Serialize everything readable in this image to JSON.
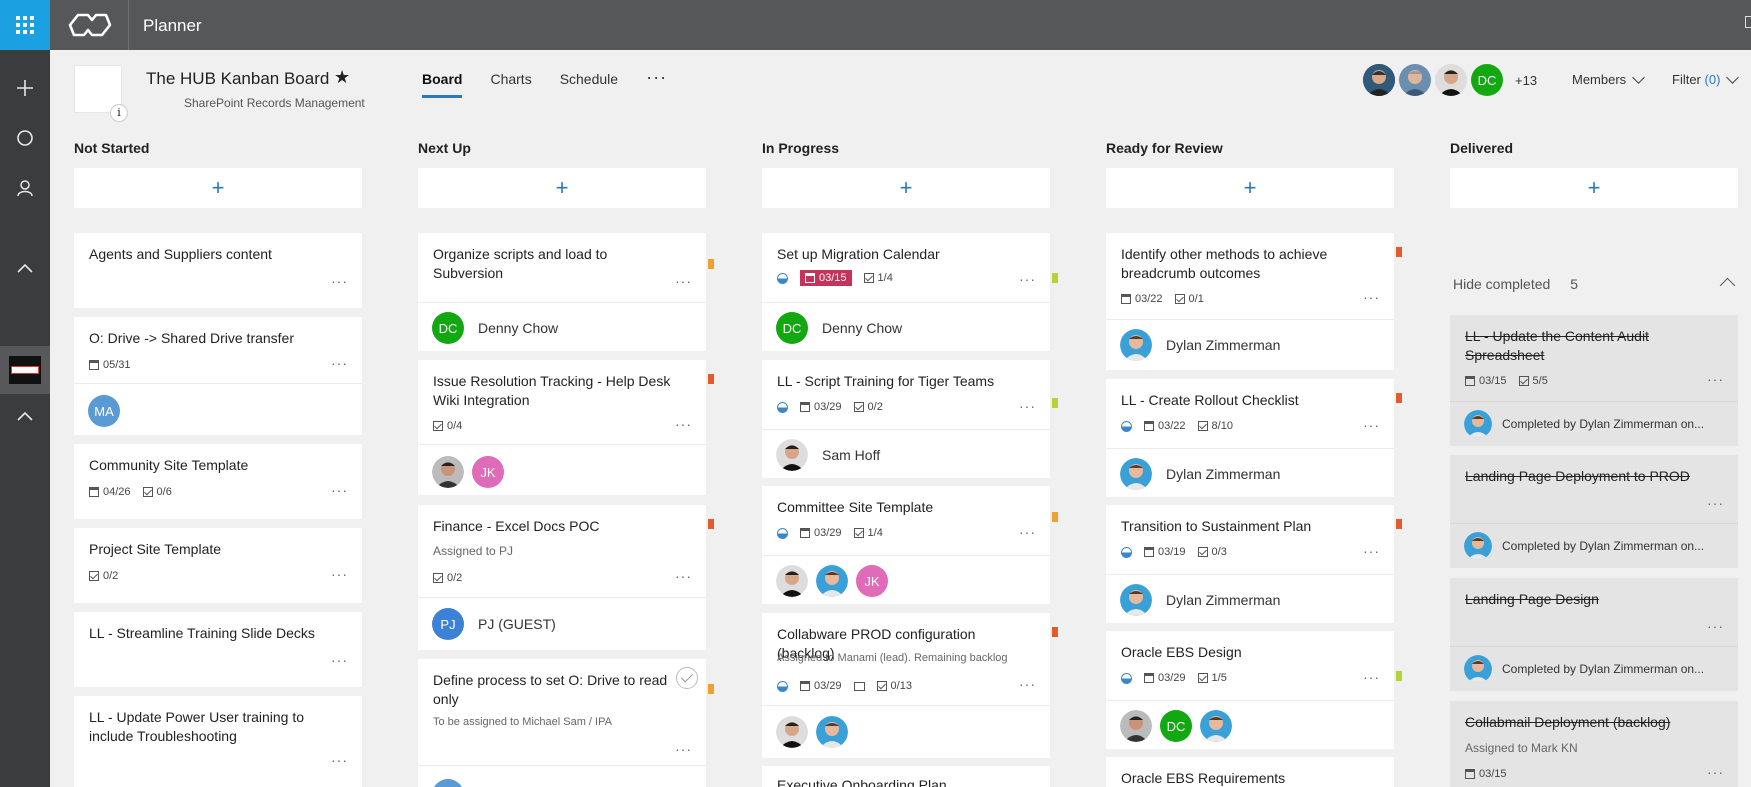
{
  "app": {
    "title": "Planner"
  },
  "plan": {
    "title": "The HUB Kanban Board",
    "subtitle": "SharePoint Records Management",
    "info_glyph": "i"
  },
  "tabs": [
    {
      "label": "Board",
      "active": true
    },
    {
      "label": "Charts",
      "active": false
    },
    {
      "label": "Schedule",
      "active": false
    }
  ],
  "more_glyph": "···",
  "members": {
    "initials_badge": "DC",
    "more": "+13",
    "label": "Members"
  },
  "filter": {
    "label": "Filter",
    "count": "(0)"
  },
  "colors": {
    "accent": "#2b78b8",
    "red": "#e25b2c",
    "orange": "#f0a030",
    "green": "#b4d334",
    "late": "#c5335b",
    "dc": "#12a812",
    "jk": "#e06bb8",
    "ma": "#5b9bd5",
    "pj": "#3b82d6"
  },
  "columns": [
    {
      "title": "Not Started"
    },
    {
      "title": "Next Up"
    },
    {
      "title": "In Progress"
    },
    {
      "title": "Ready for Review"
    },
    {
      "title": "Delivered"
    }
  ],
  "add_glyph": "+",
  "not_started": [
    {
      "title": "Agents and Suppliers content"
    },
    {
      "title": "O: Drive -> Shared Drive transfer",
      "due": "05/31",
      "avatar": "MA"
    },
    {
      "title": "Community Site Template",
      "due": "04/26",
      "checklist": "0/6"
    },
    {
      "title": "Project Site Template",
      "checklist": "0/2"
    },
    {
      "title": "LL - Streamline Training Slide Decks"
    },
    {
      "title": "LL - Update Power User training to include Troubleshooting"
    }
  ],
  "next_up": [
    {
      "title": "Organize scripts and load to Subversion",
      "assignee_initials": "DC",
      "assignee": "Denny Chow"
    },
    {
      "title": "Issue Resolution Tracking - Help Desk Wiki Integration",
      "checklist": "0/4",
      "avatar2": "JK"
    },
    {
      "title": "Finance - Excel Docs POC",
      "note": "Assigned to PJ",
      "checklist": "0/2",
      "assignee_initials": "PJ",
      "assignee": "PJ (GUEST)"
    },
    {
      "title": "Define process to set O: Drive to read only",
      "note": "To be assigned to Michael Sam / IPA"
    }
  ],
  "in_progress": [
    {
      "title": "Set up Migration Calendar",
      "due": "03/15",
      "checklist": "1/4",
      "assignee_initials": "DC",
      "assignee": "Denny Chow"
    },
    {
      "title": "LL - Script Training for Tiger Teams",
      "due": "03/29",
      "checklist": "0/2",
      "assignee": "Sam Hoff"
    },
    {
      "title": "Committee Site Template",
      "due": "03/29",
      "checklist": "1/4",
      "avatar3": "JK"
    },
    {
      "title": "Collabware PROD configuration (backlog)",
      "note": "Assigned to Manami (lead). Remaining backlog",
      "due": "03/29",
      "checklist": "0/13"
    },
    {
      "title": "Executive Onboarding Plan"
    }
  ],
  "review": [
    {
      "title": "Identify other methods to achieve breadcrumb outcomes",
      "due": "03/22",
      "checklist": "0/1",
      "assignee": "Dylan Zimmerman"
    },
    {
      "title": "LL - Create Rollout Checklist",
      "due": "03/22",
      "checklist": "8/10",
      "assignee": "Dylan Zimmerman"
    },
    {
      "title": "Transition to Sustainment Plan",
      "due": "03/19",
      "checklist": "0/3",
      "assignee": "Dylan Zimmerman"
    },
    {
      "title": "Oracle EBS Design",
      "due": "03/29",
      "checklist": "1/5",
      "avatar2": "DC"
    },
    {
      "title": "Oracle EBS Requirements"
    }
  ],
  "delivered": {
    "hide_label": "Hide completed",
    "hide_count": "5",
    "cards": [
      {
        "title": "LL - Update the Content Audit Spreadsheet",
        "due": "03/15",
        "checklist": "5/5",
        "completed": "Completed by Dylan Zimmerman on..."
      },
      {
        "title": "Landing Page Deployment to PROD",
        "completed": "Completed by Dylan Zimmerman on..."
      },
      {
        "title": "Landing Page Design",
        "completed": "Completed by Dylan Zimmerman on..."
      },
      {
        "title": "Collabmail Deployment (backlog)",
        "note": "Assigned to Mark KN",
        "due": "03/15"
      }
    ]
  }
}
